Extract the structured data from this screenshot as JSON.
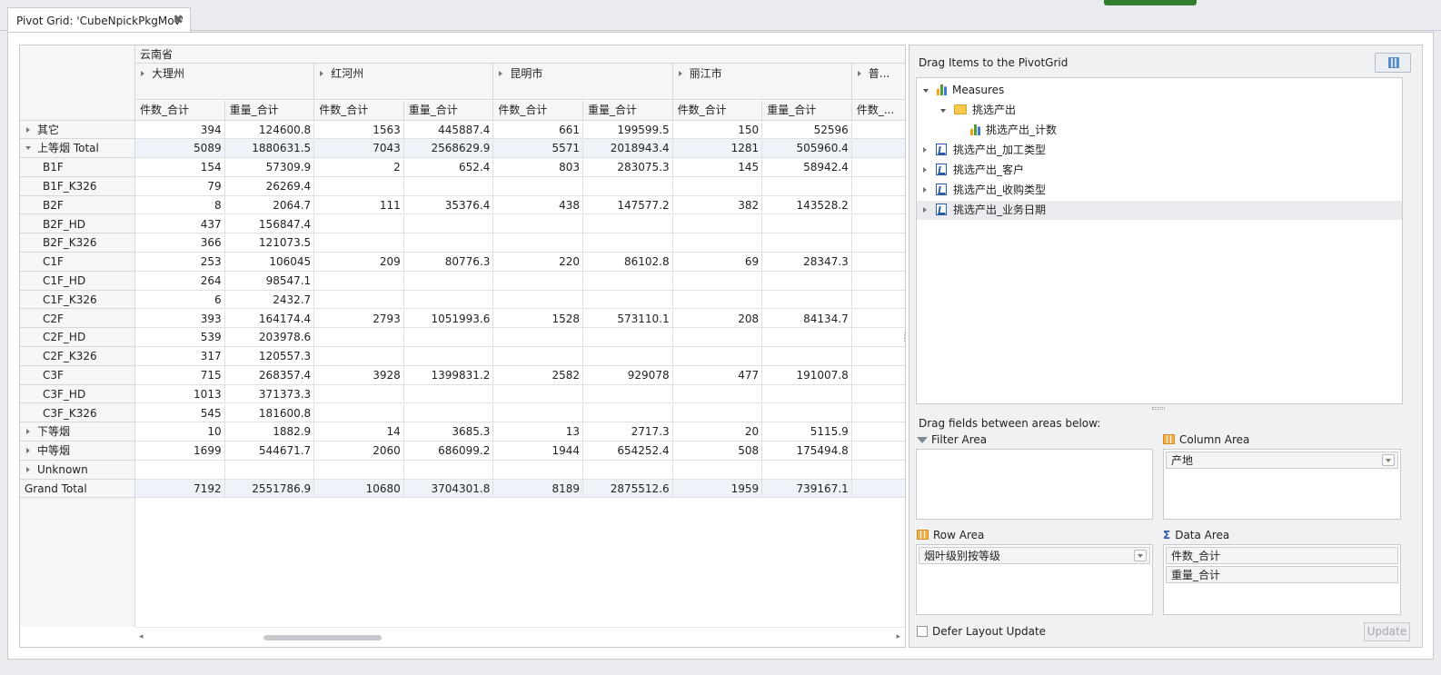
{
  "tab": {
    "title": "Pivot Grid: 'CubeNpickPkgMov'",
    "close": "✖"
  },
  "grid": {
    "province": "云南省",
    "cities": [
      "大理州",
      "红河州",
      "昆明市",
      "丽江市",
      "普..."
    ],
    "measures": [
      "件数_合计",
      "重量_合计",
      "件数_合计",
      "重量_合计",
      "件数_合计",
      "重量_合计",
      "件数_合计",
      "重量_合计",
      "件数_..."
    ],
    "rows": [
      {
        "label": "其它",
        "level": 0,
        "expander": "closed",
        "values": [
          "394",
          "124600.8",
          "1563",
          "445887.4",
          "661",
          "199599.5",
          "150",
          "52596"
        ]
      },
      {
        "label": "上等烟 Total",
        "level": 0,
        "expander": "open",
        "total": true,
        "values": [
          "5089",
          "1880631.5",
          "7043",
          "2568629.9",
          "5571",
          "2018943.4",
          "1281",
          "505960.4"
        ]
      },
      {
        "label": "B1F",
        "level": 1,
        "values": [
          "154",
          "57309.9",
          "2",
          "652.4",
          "803",
          "283075.3",
          "145",
          "58942.4"
        ]
      },
      {
        "label": "B1F_K326",
        "level": 1,
        "values": [
          "79",
          "26269.4",
          "",
          "",
          "",
          "",
          "",
          ""
        ]
      },
      {
        "label": "B2F",
        "level": 1,
        "values": [
          "8",
          "2064.7",
          "111",
          "35376.4",
          "438",
          "147577.2",
          "382",
          "143528.2"
        ]
      },
      {
        "label": "B2F_HD",
        "level": 1,
        "values": [
          "437",
          "156847.4",
          "",
          "",
          "",
          "",
          "",
          ""
        ]
      },
      {
        "label": "B2F_K326",
        "level": 1,
        "values": [
          "366",
          "121073.5",
          "",
          "",
          "",
          "",
          "",
          ""
        ]
      },
      {
        "label": "C1F",
        "level": 1,
        "values": [
          "253",
          "106045",
          "209",
          "80776.3",
          "220",
          "86102.8",
          "69",
          "28347.3"
        ]
      },
      {
        "label": "C1F_HD",
        "level": 1,
        "values": [
          "264",
          "98547.1",
          "",
          "",
          "",
          "",
          "",
          ""
        ]
      },
      {
        "label": "C1F_K326",
        "level": 1,
        "values": [
          "6",
          "2432.7",
          "",
          "",
          "",
          "",
          "",
          ""
        ]
      },
      {
        "label": "C2F",
        "level": 1,
        "values": [
          "393",
          "164174.4",
          "2793",
          "1051993.6",
          "1528",
          "573110.1",
          "208",
          "84134.7"
        ]
      },
      {
        "label": "C2F_HD",
        "level": 1,
        "values": [
          "539",
          "203978.6",
          "",
          "",
          "",
          "",
          "",
          ""
        ]
      },
      {
        "label": "C2F_K326",
        "level": 1,
        "values": [
          "317",
          "120557.3",
          "",
          "",
          "",
          "",
          "",
          ""
        ]
      },
      {
        "label": "C3F",
        "level": 1,
        "values": [
          "715",
          "268357.4",
          "3928",
          "1399831.2",
          "2582",
          "929078",
          "477",
          "191007.8"
        ]
      },
      {
        "label": "C3F_HD",
        "level": 1,
        "values": [
          "1013",
          "371373.3",
          "",
          "",
          "",
          "",
          "",
          ""
        ]
      },
      {
        "label": "C3F_K326",
        "level": 1,
        "values": [
          "545",
          "181600.8",
          "",
          "",
          "",
          "",
          "",
          ""
        ]
      },
      {
        "label": "下等烟",
        "level": 0,
        "expander": "closed",
        "values": [
          "10",
          "1882.9",
          "14",
          "3685.3",
          "13",
          "2717.3",
          "20",
          "5115.9"
        ]
      },
      {
        "label": "中等烟",
        "level": 0,
        "expander": "closed",
        "values": [
          "1699",
          "544671.7",
          "2060",
          "686099.2",
          "1944",
          "654252.4",
          "508",
          "175494.8"
        ]
      },
      {
        "label": "Unknown",
        "level": 0,
        "expander": "closed",
        "values": [
          "",
          "",
          "",
          "",
          "",
          "",
          "",
          ""
        ]
      },
      {
        "label": "Grand Total",
        "level": 0,
        "grand": true,
        "values": [
          "7192",
          "2551786.9",
          "10680",
          "3704301.8",
          "8189",
          "2875512.6",
          "1959",
          "739167.1"
        ]
      }
    ]
  },
  "fieldList": {
    "title": "Drag Items to the PivotGrid",
    "tree": [
      {
        "label": "Measures",
        "indent": 0,
        "icon": "measures-icon",
        "tri": "open"
      },
      {
        "label": "挑选产出",
        "indent": 1,
        "icon": "folder-icon",
        "tri": "open"
      },
      {
        "label": "挑选产出_计数",
        "indent": 2,
        "icon": "measure-icon",
        "tri": ""
      },
      {
        "label": "挑选产出_加工类型",
        "indent": 0,
        "icon": "dimension-icon",
        "tri": "closed"
      },
      {
        "label": "挑选产出_客户",
        "indent": 0,
        "icon": "dimension-icon",
        "tri": "closed"
      },
      {
        "label": "挑选产出_收购类型",
        "indent": 0,
        "icon": "dimension-icon",
        "tri": "closed"
      },
      {
        "label": "挑选产出_业务日期",
        "indent": 0,
        "icon": "dimension-icon",
        "tri": "closed",
        "selected": true
      }
    ],
    "areasLabel": "Drag fields between areas below:",
    "filterArea": {
      "title": "Filter Area",
      "items": []
    },
    "columnArea": {
      "title": "Column Area",
      "items": [
        "产地"
      ]
    },
    "rowArea": {
      "title": "Row Area",
      "items": [
        "烟叶级别按等级"
      ]
    },
    "dataArea": {
      "title": "Data Area",
      "items": [
        "件数_合计",
        "重量_合计"
      ]
    },
    "defer": "Defer Layout Update",
    "update": "Update"
  }
}
